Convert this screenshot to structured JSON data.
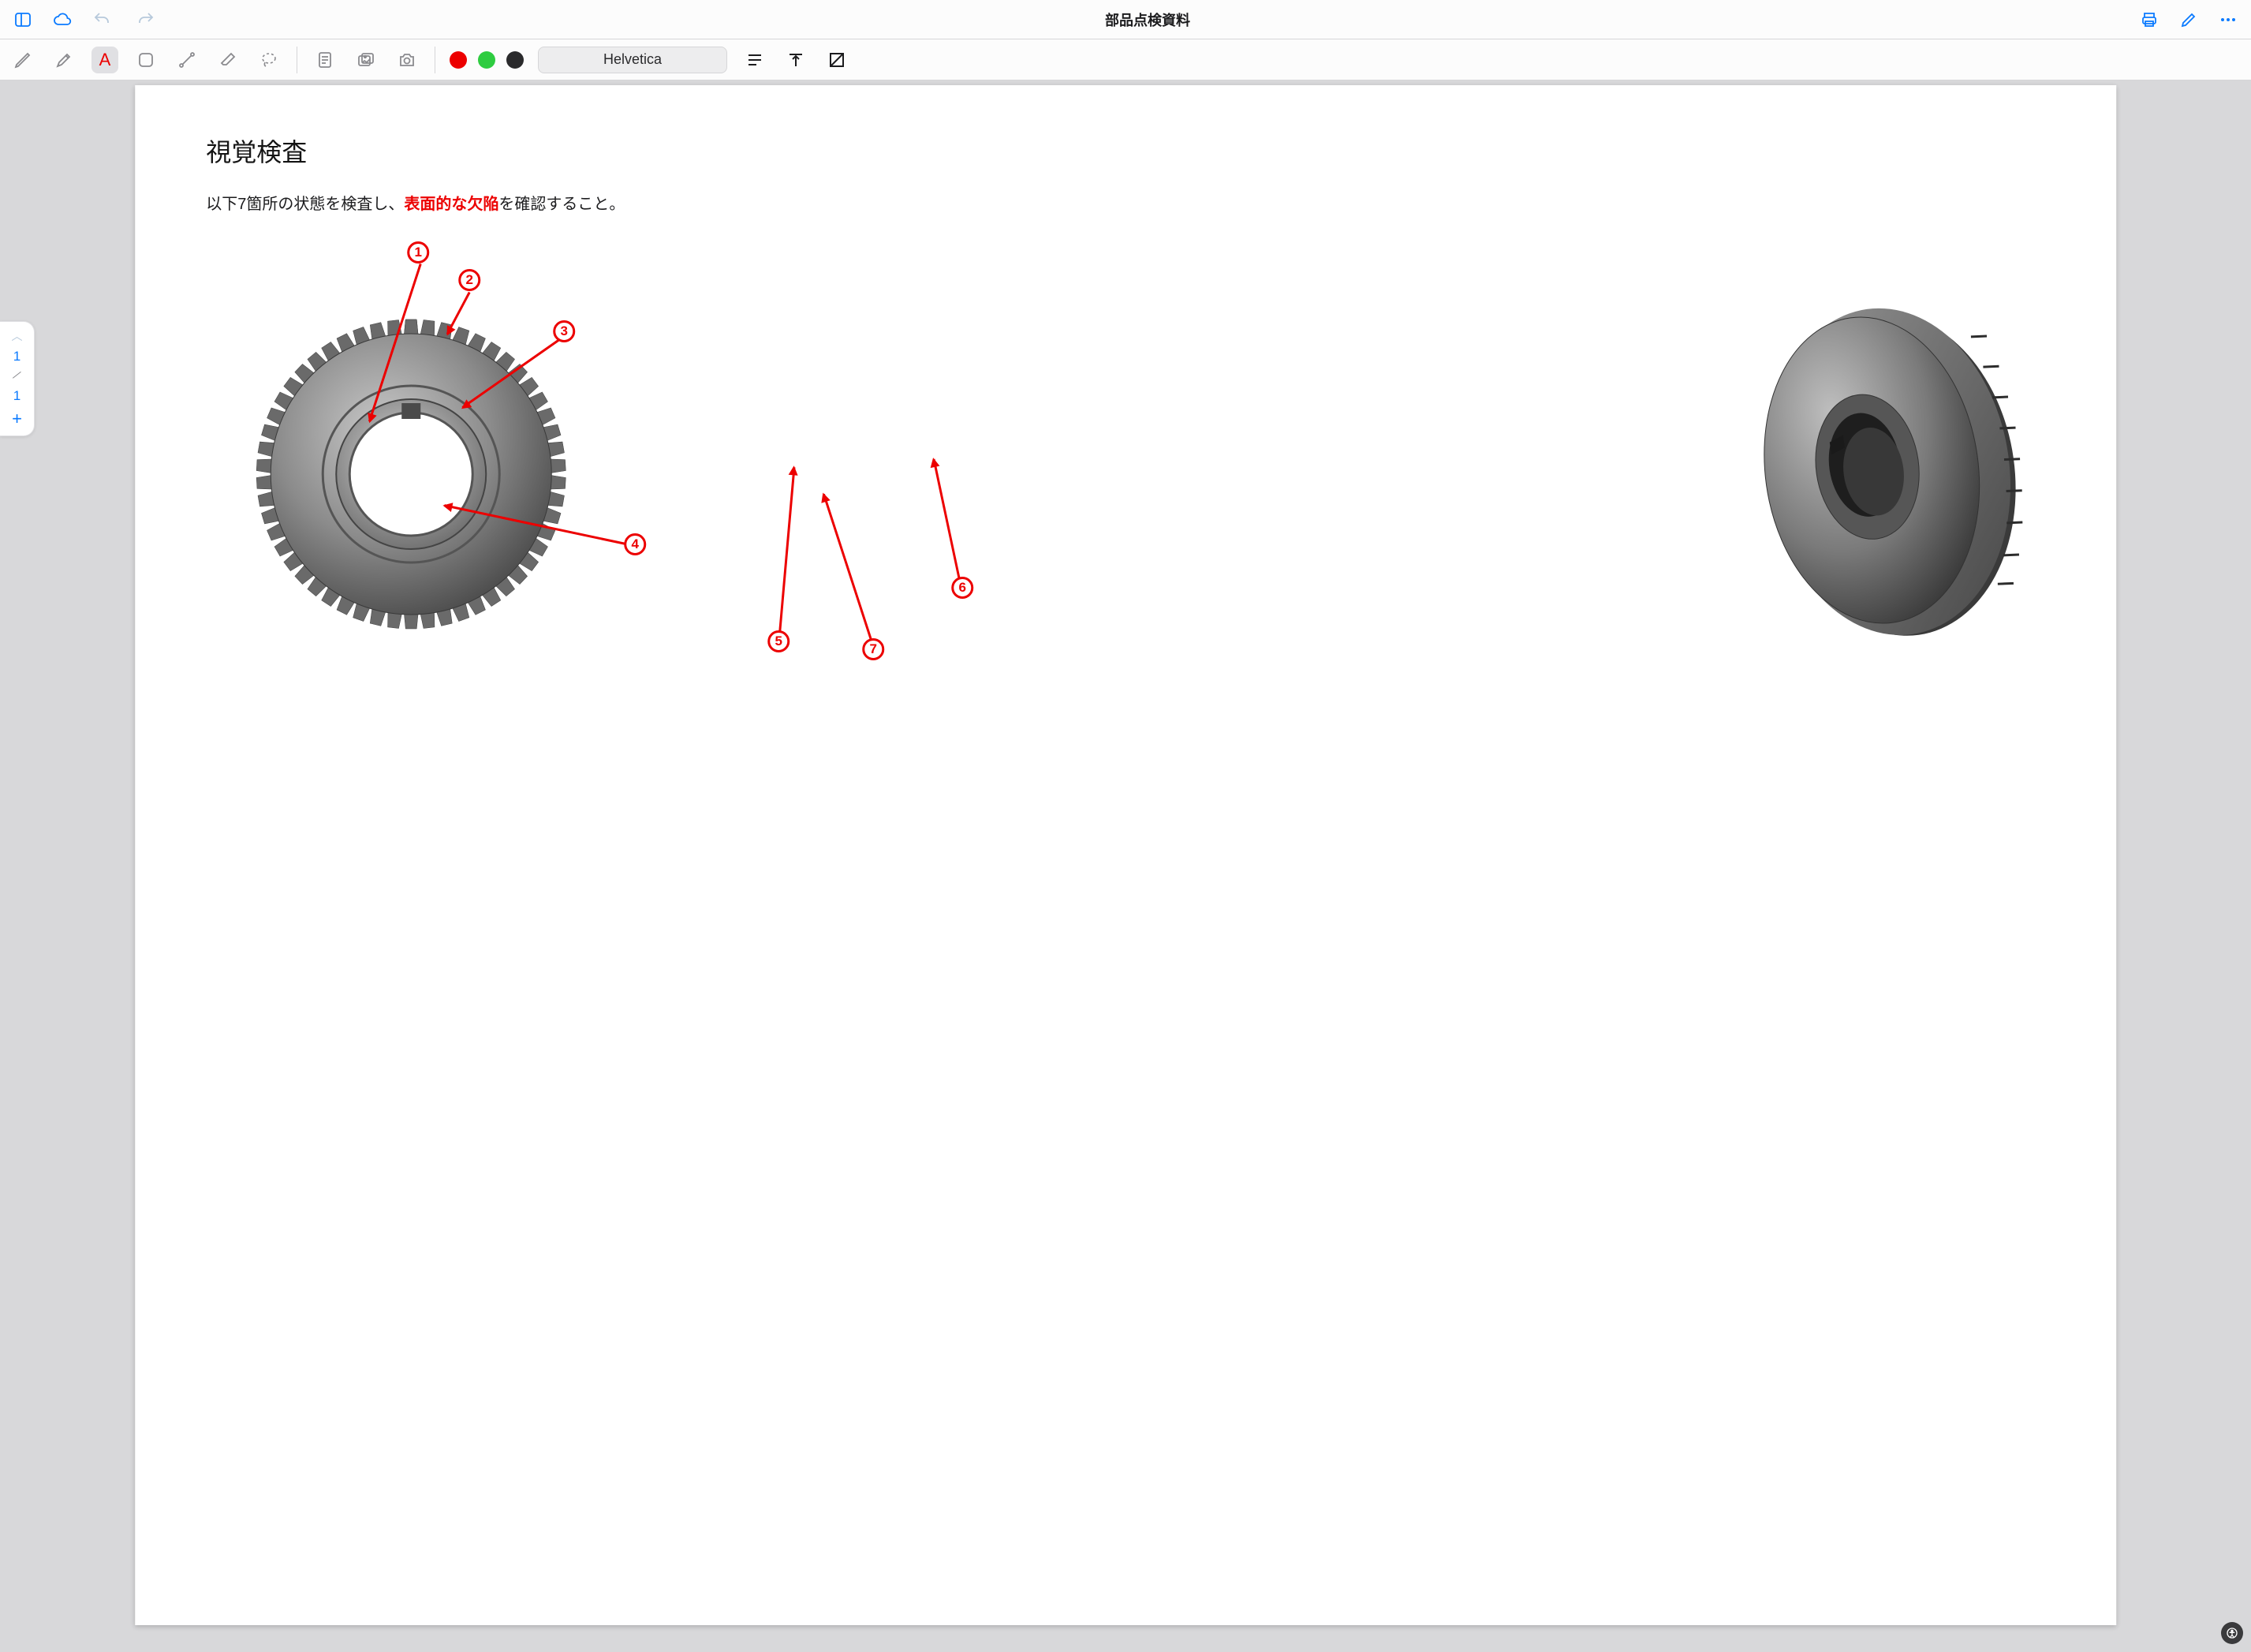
{
  "titlebar": {
    "title": "部品点検資料"
  },
  "toolbar": {
    "text_tool_glyph": "A",
    "colors": {
      "c1": "#ec0000",
      "c2": "#2ecc40",
      "c3": "#2a2a2c"
    },
    "font_name": "Helvetica"
  },
  "pagenav": {
    "current": "1",
    "total": "1",
    "plus": "+"
  },
  "document": {
    "heading": "視覚検査",
    "sentence_pre": "以下7箇所の状態を検査し、",
    "sentence_highlight": "表面的な欠陥",
    "sentence_post": "を確認すること。",
    "callouts": {
      "n1": "1",
      "n2": "2",
      "n3": "3",
      "n4": "4",
      "n5": "5",
      "n6": "6",
      "n7": "7"
    }
  }
}
